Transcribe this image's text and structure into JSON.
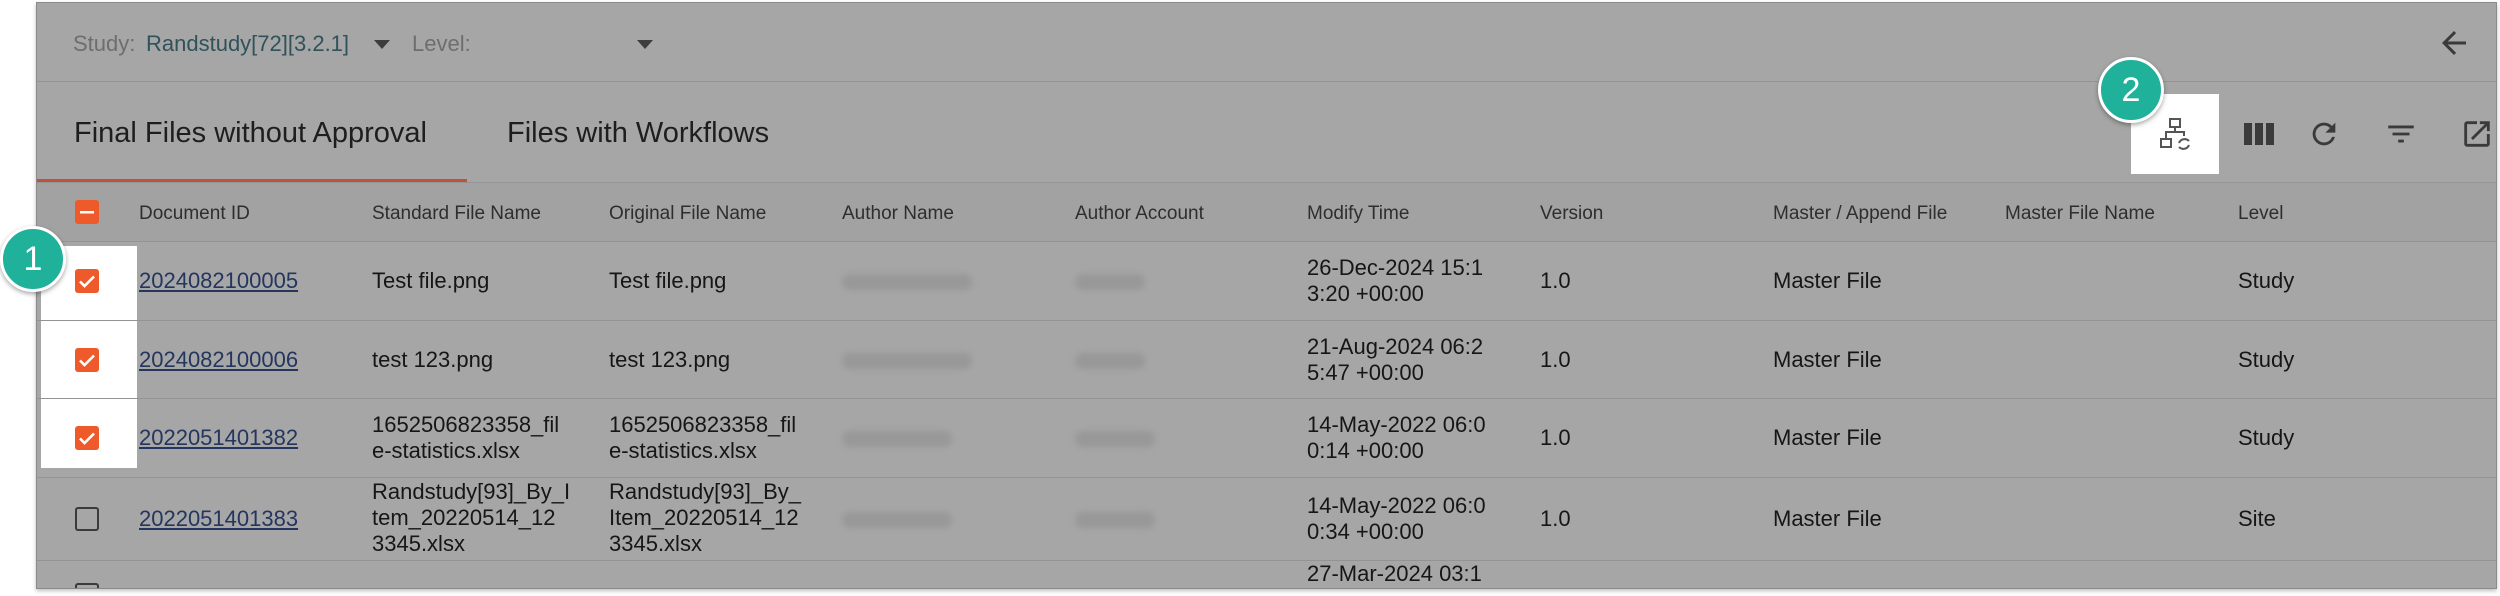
{
  "filter_bar": {
    "study_label": "Study:",
    "study_value": "Randstudy[72][3.2.1]",
    "level_label": "Level:",
    "level_value": ""
  },
  "tabs": [
    {
      "label": "Final Files without Approval",
      "active": true
    },
    {
      "label": "Files with Workflows",
      "active": false
    }
  ],
  "toolbar": {
    "icons": [
      "workflow-sync-icon",
      "columns-icon",
      "refresh-icon",
      "filter-icon",
      "export-icon"
    ]
  },
  "table": {
    "headers": [
      "Document ID",
      "Standard File Name",
      "Original File Name",
      "Author Name",
      "Author Account",
      "Modify Time",
      "Version",
      "Master / Append File",
      "Master File Name",
      "Level"
    ],
    "rows": [
      {
        "checked": true,
        "doc_id": "2024082100005",
        "std_name": [
          "Test file.png"
        ],
        "orig_name": [
          "Test file.png"
        ],
        "modify": [
          "26-Dec-2024 15:1",
          "3:20 +00:00"
        ],
        "version": "1.0",
        "master_append": "Master File",
        "master_name": "",
        "level": "Study"
      },
      {
        "checked": true,
        "doc_id": "2024082100006",
        "std_name": [
          "test 123.png"
        ],
        "orig_name": [
          "test 123.png"
        ],
        "modify": [
          "21-Aug-2024 06:2",
          "5:47 +00:00"
        ],
        "version": "1.0",
        "master_append": "Master File",
        "master_name": "",
        "level": "Study"
      },
      {
        "checked": true,
        "doc_id": "2022051401382",
        "std_name": [
          "1652506823358_fil",
          "e-statistics.xlsx"
        ],
        "orig_name": [
          "1652506823358_fil",
          "e-statistics.xlsx"
        ],
        "modify": [
          "14-May-2022 06:0",
          "0:14 +00:00"
        ],
        "version": "1.0",
        "master_append": "Master File",
        "master_name": "",
        "level": "Study"
      },
      {
        "checked": false,
        "doc_id": "2022051401383",
        "std_name": [
          "Randstudy[93]_By_I",
          "tem_20220514_12",
          "3345.xlsx"
        ],
        "orig_name": [
          "Randstudy[93]_By_",
          "Item_20220514_12",
          "3345.xlsx"
        ],
        "modify": [
          "14-May-2022 06:0",
          "0:34 +00:00"
        ],
        "version": "1.0",
        "master_append": "Master File",
        "master_name": "",
        "level": "Site"
      },
      {
        "checked": false,
        "doc_id": "",
        "std_name": [
          ""
        ],
        "orig_name": [
          ""
        ],
        "modify": [
          "27-Mar-2024 03:1"
        ],
        "version": "",
        "master_append": "",
        "master_name": "",
        "level": ""
      }
    ]
  },
  "callouts": [
    "1",
    "2"
  ],
  "colors": {
    "accent": "#ef5a2b",
    "callout": "#1fb19a",
    "link": "#24355e",
    "overlay_gray": "#a6a6a6"
  }
}
